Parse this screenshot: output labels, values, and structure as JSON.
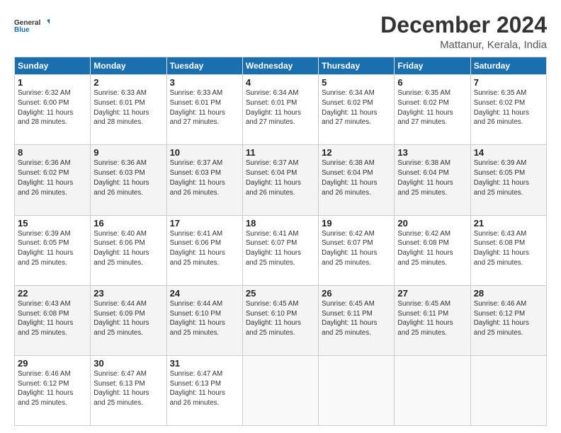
{
  "logo": {
    "line1": "General",
    "line2": "Blue"
  },
  "title": "December 2024",
  "subtitle": "Mattanur, Kerala, India",
  "headers": [
    "Sunday",
    "Monday",
    "Tuesday",
    "Wednesday",
    "Thursday",
    "Friday",
    "Saturday"
  ],
  "weeks": [
    [
      {
        "day": "1",
        "info": "Sunrise: 6:32 AM\nSunset: 6:00 PM\nDaylight: 11 hours\nand 28 minutes."
      },
      {
        "day": "2",
        "info": "Sunrise: 6:33 AM\nSunset: 6:01 PM\nDaylight: 11 hours\nand 28 minutes."
      },
      {
        "day": "3",
        "info": "Sunrise: 6:33 AM\nSunset: 6:01 PM\nDaylight: 11 hours\nand 27 minutes."
      },
      {
        "day": "4",
        "info": "Sunrise: 6:34 AM\nSunset: 6:01 PM\nDaylight: 11 hours\nand 27 minutes."
      },
      {
        "day": "5",
        "info": "Sunrise: 6:34 AM\nSunset: 6:02 PM\nDaylight: 11 hours\nand 27 minutes."
      },
      {
        "day": "6",
        "info": "Sunrise: 6:35 AM\nSunset: 6:02 PM\nDaylight: 11 hours\nand 27 minutes."
      },
      {
        "day": "7",
        "info": "Sunrise: 6:35 AM\nSunset: 6:02 PM\nDaylight: 11 hours\nand 26 minutes."
      }
    ],
    [
      {
        "day": "8",
        "info": "Sunrise: 6:36 AM\nSunset: 6:02 PM\nDaylight: 11 hours\nand 26 minutes."
      },
      {
        "day": "9",
        "info": "Sunrise: 6:36 AM\nSunset: 6:03 PM\nDaylight: 11 hours\nand 26 minutes."
      },
      {
        "day": "10",
        "info": "Sunrise: 6:37 AM\nSunset: 6:03 PM\nDaylight: 11 hours\nand 26 minutes."
      },
      {
        "day": "11",
        "info": "Sunrise: 6:37 AM\nSunset: 6:04 PM\nDaylight: 11 hours\nand 26 minutes."
      },
      {
        "day": "12",
        "info": "Sunrise: 6:38 AM\nSunset: 6:04 PM\nDaylight: 11 hours\nand 26 minutes."
      },
      {
        "day": "13",
        "info": "Sunrise: 6:38 AM\nSunset: 6:04 PM\nDaylight: 11 hours\nand 25 minutes."
      },
      {
        "day": "14",
        "info": "Sunrise: 6:39 AM\nSunset: 6:05 PM\nDaylight: 11 hours\nand 25 minutes."
      }
    ],
    [
      {
        "day": "15",
        "info": "Sunrise: 6:39 AM\nSunset: 6:05 PM\nDaylight: 11 hours\nand 25 minutes."
      },
      {
        "day": "16",
        "info": "Sunrise: 6:40 AM\nSunset: 6:06 PM\nDaylight: 11 hours\nand 25 minutes."
      },
      {
        "day": "17",
        "info": "Sunrise: 6:41 AM\nSunset: 6:06 PM\nDaylight: 11 hours\nand 25 minutes."
      },
      {
        "day": "18",
        "info": "Sunrise: 6:41 AM\nSunset: 6:07 PM\nDaylight: 11 hours\nand 25 minutes."
      },
      {
        "day": "19",
        "info": "Sunrise: 6:42 AM\nSunset: 6:07 PM\nDaylight: 11 hours\nand 25 minutes."
      },
      {
        "day": "20",
        "info": "Sunrise: 6:42 AM\nSunset: 6:08 PM\nDaylight: 11 hours\nand 25 minutes."
      },
      {
        "day": "21",
        "info": "Sunrise: 6:43 AM\nSunset: 6:08 PM\nDaylight: 11 hours\nand 25 minutes."
      }
    ],
    [
      {
        "day": "22",
        "info": "Sunrise: 6:43 AM\nSunset: 6:08 PM\nDaylight: 11 hours\nand 25 minutes."
      },
      {
        "day": "23",
        "info": "Sunrise: 6:44 AM\nSunset: 6:09 PM\nDaylight: 11 hours\nand 25 minutes."
      },
      {
        "day": "24",
        "info": "Sunrise: 6:44 AM\nSunset: 6:10 PM\nDaylight: 11 hours\nand 25 minutes."
      },
      {
        "day": "25",
        "info": "Sunrise: 6:45 AM\nSunset: 6:10 PM\nDaylight: 11 hours\nand 25 minutes."
      },
      {
        "day": "26",
        "info": "Sunrise: 6:45 AM\nSunset: 6:11 PM\nDaylight: 11 hours\nand 25 minutes."
      },
      {
        "day": "27",
        "info": "Sunrise: 6:45 AM\nSunset: 6:11 PM\nDaylight: 11 hours\nand 25 minutes."
      },
      {
        "day": "28",
        "info": "Sunrise: 6:46 AM\nSunset: 6:12 PM\nDaylight: 11 hours\nand 25 minutes."
      }
    ],
    [
      {
        "day": "29",
        "info": "Sunrise: 6:46 AM\nSunset: 6:12 PM\nDaylight: 11 hours\nand 25 minutes."
      },
      {
        "day": "30",
        "info": "Sunrise: 6:47 AM\nSunset: 6:13 PM\nDaylight: 11 hours\nand 25 minutes."
      },
      {
        "day": "31",
        "info": "Sunrise: 6:47 AM\nSunset: 6:13 PM\nDaylight: 11 hours\nand 26 minutes."
      },
      {
        "day": "",
        "info": ""
      },
      {
        "day": "",
        "info": ""
      },
      {
        "day": "",
        "info": ""
      },
      {
        "day": "",
        "info": ""
      }
    ]
  ]
}
